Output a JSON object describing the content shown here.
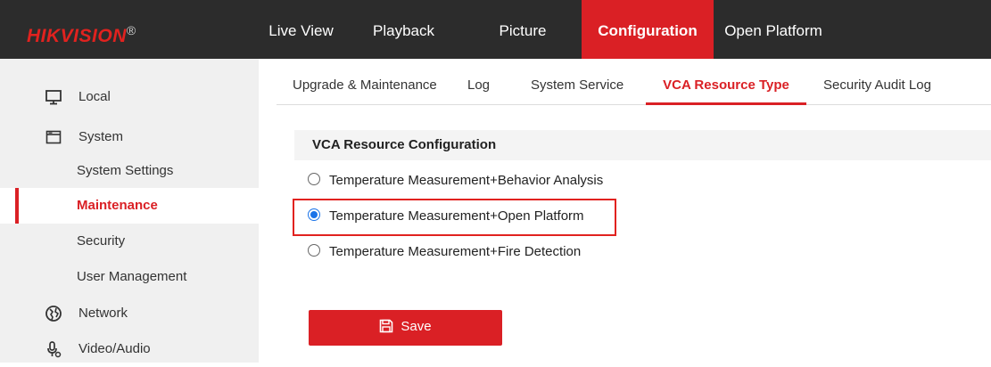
{
  "brand": {
    "name_hik": "HIK",
    "name_vision": "VISION",
    "reg_mark": "®"
  },
  "top_nav": {
    "items": [
      {
        "label": "Live View"
      },
      {
        "label": "Playback"
      },
      {
        "label": "Picture"
      },
      {
        "label": "Configuration",
        "active": true
      },
      {
        "label": "Open Platform"
      }
    ]
  },
  "sidebar": {
    "items": [
      {
        "label": "Local",
        "icon": "monitor-icon"
      },
      {
        "label": "System",
        "icon": "system-window-icon"
      },
      {
        "label": "System Settings"
      },
      {
        "label": "Maintenance",
        "active": true
      },
      {
        "label": "Security"
      },
      {
        "label": "User Management"
      },
      {
        "label": "Network",
        "icon": "globe-icon"
      },
      {
        "label": "Video/Audio",
        "icon": "microphone-icon"
      }
    ]
  },
  "tabs": {
    "items": [
      {
        "label": "Upgrade & Maintenance"
      },
      {
        "label": "Log"
      },
      {
        "label": "System Service"
      },
      {
        "label": "VCA Resource Type",
        "active": true
      },
      {
        "label": "Security Audit Log"
      }
    ]
  },
  "section": {
    "title": "VCA Resource Configuration"
  },
  "options": [
    {
      "label": "Temperature Measurement+Behavior Analysis",
      "checked": false
    },
    {
      "label": "Temperature Measurement+Open Platform",
      "checked": true
    },
    {
      "label": "Temperature Measurement+Fire Detection",
      "checked": false
    }
  ],
  "save": {
    "label": "Save",
    "icon": "floppy-disk-icon"
  },
  "colors": {
    "accent": "#da2025",
    "topbar": "#2c2c2c",
    "sidebar": "#f0f0f0",
    "radio_checked": "#1a73e8"
  }
}
